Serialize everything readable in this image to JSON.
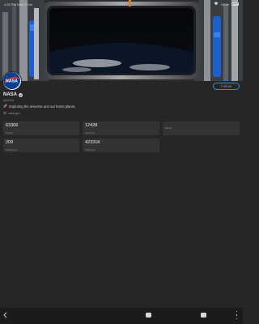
{
  "status_bar": {
    "time": "4:32 PM Wed 9 Oct",
    "battery": "100%"
  },
  "profile": {
    "name": "NASA",
    "handle": "@NASA",
    "bio_emoji": "🚀",
    "bio": "Exploring the universe and our home planet.",
    "website": "nasa.gov",
    "follow_label": "Follow",
    "verified_icon": "verified-badge-icon"
  },
  "stats": [
    {
      "value": "63306",
      "label": "Tweets"
    },
    {
      "value": "12428",
      "label": "Favorites"
    },
    {
      "value": "",
      "label": "Media"
    },
    {
      "value": "209",
      "label": "Followings"
    },
    {
      "value": "42331K",
      "label": "Followers"
    }
  ],
  "nav": {
    "back_icon": "back-arrow-icon",
    "more_icon": "more-vertical-icon"
  },
  "colors": {
    "background": "#262626",
    "card": "#333333",
    "accent": "#3a8ad6",
    "bottom_bar": "#1b1b1b"
  }
}
